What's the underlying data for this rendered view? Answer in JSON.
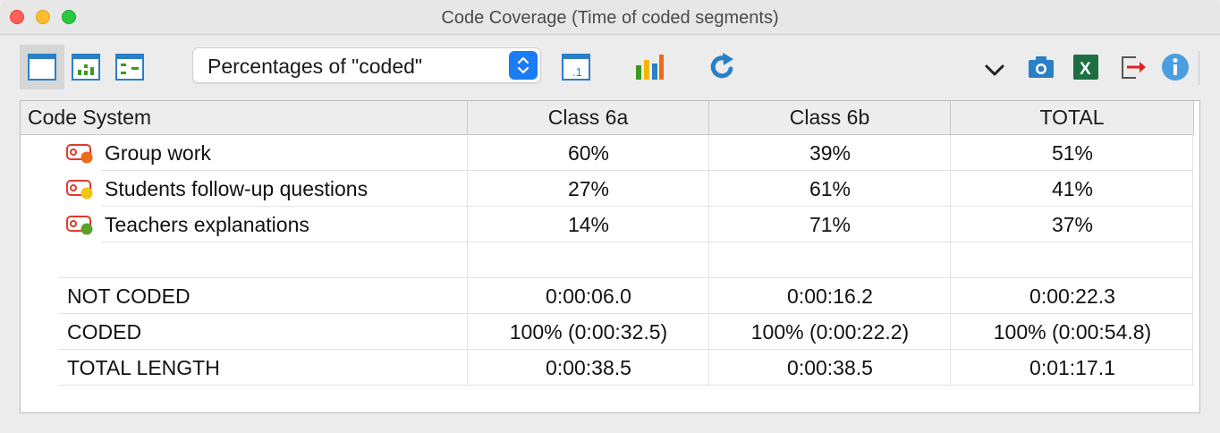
{
  "window": {
    "title": "Code Coverage (Time of coded segments)"
  },
  "toolbar": {
    "view_buttons": [
      "table-view-icon",
      "grid-bars-icon",
      "grid-dashes-icon"
    ],
    "select_value": "Percentages of \"coded\"",
    "decimals_icon_label": ".1"
  },
  "table": {
    "headers": [
      "Code System",
      "Class 6a",
      "Class 6b",
      "TOTAL"
    ],
    "codes": [
      {
        "name": "Group work",
        "color": "#ee6a1b",
        "values": [
          "60%",
          "39%",
          "51%"
        ]
      },
      {
        "name": "Students follow-up questions",
        "color": "#f2c511",
        "values": [
          "27%",
          "61%",
          "41%"
        ]
      },
      {
        "name": "Teachers explanations",
        "color": "#5aa228",
        "values": [
          "14%",
          "71%",
          "37%"
        ]
      }
    ],
    "summary": [
      {
        "label": "NOT CODED",
        "values": [
          "0:00:06.0",
          "0:00:16.2",
          "0:00:22.3"
        ]
      },
      {
        "label": "CODED",
        "values": [
          "100% (0:00:32.5)",
          "100% (0:00:22.2)",
          "100% (0:00:54.8)"
        ]
      },
      {
        "label": "TOTAL LENGTH",
        "values": [
          "0:00:38.5",
          "0:00:38.5",
          "0:01:17.1"
        ]
      }
    ]
  },
  "colors": {
    "accent": "#1a7cf7",
    "excel": "#1d6f42",
    "refresh": "#2a7fc6"
  }
}
